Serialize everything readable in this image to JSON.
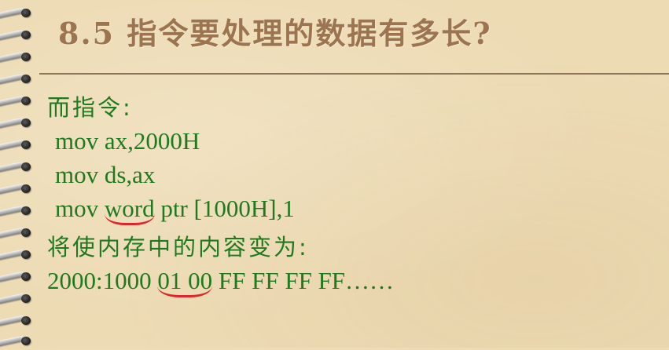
{
  "slide": {
    "title": "8.5 指令要处理的数据有多长?",
    "intro": "而指令:",
    "code_lines": [
      "mov ax,2000H",
      "mov ds,ax"
    ],
    "line3": {
      "prefix": "mov ",
      "highlight": "word",
      "suffix": " ptr [1000H],1"
    },
    "result_label": "将使内存中的内容变为:",
    "memory_line": {
      "prefix": "2000:1000 ",
      "highlight": "01 00",
      "suffix": " FF FF FF FF……"
    }
  },
  "colors": {
    "background": "#eddbb4",
    "title": "#9c7450",
    "body_text": "#1f7a1f",
    "annotation": "#e0242a"
  }
}
